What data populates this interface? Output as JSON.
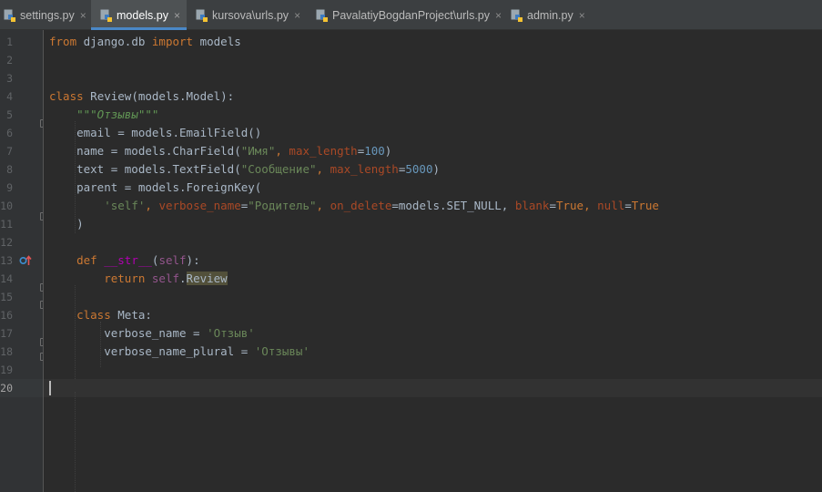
{
  "tabs": [
    {
      "label": "settings.py",
      "active": false
    },
    {
      "label": "models.py",
      "active": true
    },
    {
      "label": "kursova\\urls.py",
      "active": false
    },
    {
      "label": "PavalatiyBogdanProject\\urls.py",
      "active": false
    },
    {
      "label": "admin.py",
      "active": false
    }
  ],
  "tab_close_glyph": "×",
  "editor": {
    "line_numbers": [
      "1",
      "2",
      "3",
      "4",
      "5",
      "6",
      "7",
      "8",
      "9",
      "10",
      "11",
      "12",
      "13",
      "14",
      "15",
      "16",
      "17",
      "18",
      "19",
      "20"
    ],
    "current_line": "20",
    "code": {
      "l1": {
        "t1": "from",
        "t2": " django.db ",
        "t3": "import",
        "t4": " models"
      },
      "l4": {
        "t1": "class",
        "t2": " Review(models.Model):"
      },
      "l5": {
        "t1": "    \"\"\"Отзывы\"\"\""
      },
      "l6": {
        "t1": "    email = models.EmailField()"
      },
      "l7": {
        "t1": "    name = models.CharField(",
        "t2": "\"Имя\"",
        "t3": ", ",
        "t4": "max_length",
        "t5": "=",
        "t6": "100",
        "t7": ")"
      },
      "l8": {
        "t1": "    text = models.TextField(",
        "t2": "\"Сообщение\"",
        "t3": ", ",
        "t4": "max_length",
        "t5": "=",
        "t6": "5000",
        "t7": ")"
      },
      "l9": {
        "t1": "    parent = models.ForeignKey("
      },
      "l10": {
        "t1": "        ",
        "t2": "'self'",
        "t3": ", ",
        "t4": "verbose_name",
        "t5": "=",
        "t6": "\"Родитель\"",
        "t7": ", ",
        "t8": "on_delete",
        "t9": "=models.SET_NULL, ",
        "t10": "blank",
        "t11": "=",
        "t12": "True",
        "t13": ", ",
        "t14": "null",
        "t15": "=",
        "t16": "True"
      },
      "l11": {
        "t1": "    )"
      },
      "l13": {
        "t1": "    ",
        "t2": "def",
        "t3": " ",
        "t4": "__str__",
        "t5": "(",
        "t6": "self",
        "t7": "):"
      },
      "l14": {
        "t1": "        ",
        "t2": "return",
        "t3": " ",
        "t4": "self",
        "t5": ".",
        "t6": "Review"
      },
      "l16": {
        "t1": "    ",
        "t2": "class",
        "t3": " Meta:"
      },
      "l17": {
        "t1": "        verbose_name = ",
        "t2": "'Отзыв'"
      },
      "l18": {
        "t1": "        verbose_name_plural = ",
        "t2": "'Отзывы'"
      }
    }
  },
  "colors": {
    "background": "#2b2b2b",
    "gutter": "#313335",
    "tabbar": "#3c3f41",
    "active_tab": "#4e5254",
    "keyword": "#cc7832",
    "string": "#6a8759",
    "number": "#6897bb",
    "kwarg": "#aa4926",
    "self": "#94558d",
    "default_text": "#a9b7c6"
  },
  "icons": {
    "tab_icon": "python-file-icon",
    "gutter_icon": "overrides-method-icon"
  }
}
